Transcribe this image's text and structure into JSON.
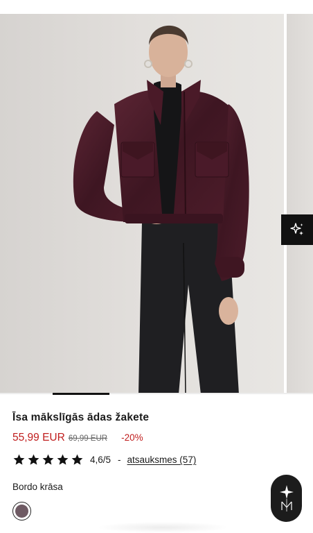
{
  "gallery": {
    "image_description_icon": "jacket-photo",
    "active_slide_fraction": 0.18
  },
  "ai_button": {
    "icon": "sparkles-icon"
  },
  "product": {
    "title": "Īsa mākslīgās ādas žakete",
    "price_current": "55,99 EUR",
    "price_old": "69,99 EUR",
    "discount": "-20%"
  },
  "rating": {
    "stars": 5,
    "value_text": "4,6/5",
    "separator": "-",
    "reviews_link": "atsauksmes (57)"
  },
  "color": {
    "label": "Bordo krāsa",
    "swatch_color": "#6e5a63"
  },
  "chat_badge": {
    "icon": "brand-logo-icon"
  },
  "colors": {
    "price_red": "#c01d1d",
    "text": "#1a1a1a"
  }
}
